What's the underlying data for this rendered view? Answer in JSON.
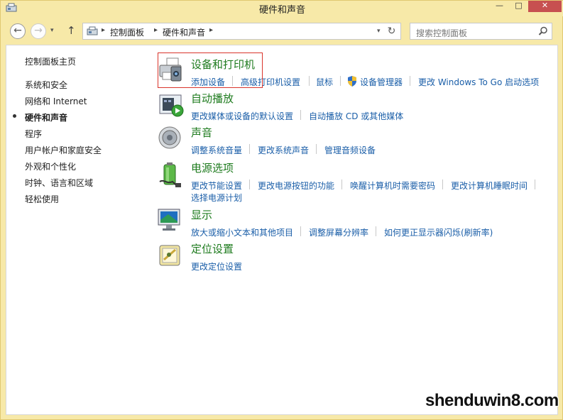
{
  "window": {
    "title": "硬件和声音",
    "min_label": "—",
    "max_label": "□",
    "close_label": "✕"
  },
  "nav": {
    "back": "←",
    "forward": "→",
    "dropdown": "▾",
    "up": "↑",
    "refresh": "↻",
    "crumbs": [
      "控制面板",
      "硬件和声音"
    ],
    "crumb_sep": "▸",
    "search_placeholder": "搜索控制面板"
  },
  "sidebar": {
    "home": "控制面板主页",
    "items": [
      "系统和安全",
      "网络和 Internet",
      "硬件和声音",
      "程序",
      "用户帐户和家庭安全",
      "外观和个性化",
      "时钟、语言和区域",
      "轻松使用"
    ],
    "active_index": 2
  },
  "categories": [
    {
      "title": "设备和打印机",
      "icon": "printer-icon",
      "links": [
        "添加设备",
        "高级打印机设置",
        "鼠标",
        "设备管理器",
        "更改 Windows To Go 启动选项"
      ]
    },
    {
      "title": "自动播放",
      "icon": "autoplay-icon",
      "links": [
        "更改媒体或设备的默认设置",
        "自动播放 CD 或其他媒体"
      ]
    },
    {
      "title": "声音",
      "icon": "speaker-icon",
      "links": [
        "调整系统音量",
        "更改系统声音",
        "管理音频设备"
      ]
    },
    {
      "title": "电源选项",
      "icon": "battery-icon",
      "links": [
        "更改节能设置",
        "更改电源按钮的功能",
        "唤醒计算机时需要密码",
        "更改计算机睡眠时间",
        "选择电源计划"
      ]
    },
    {
      "title": "显示",
      "icon": "monitor-icon",
      "links": [
        "放大或缩小文本和其他项目",
        "调整屏幕分辨率",
        "如何更正显示器闪烁(刷新率)"
      ]
    },
    {
      "title": "定位设置",
      "icon": "location-icon",
      "links": [
        "更改定位设置"
      ]
    }
  ],
  "watermark": "shenduwin8.com",
  "colors": {
    "frame": "#f7e9a8",
    "link": "#1a5ea8",
    "category_title": "#1e7b1e",
    "highlight": "#d9342b"
  }
}
